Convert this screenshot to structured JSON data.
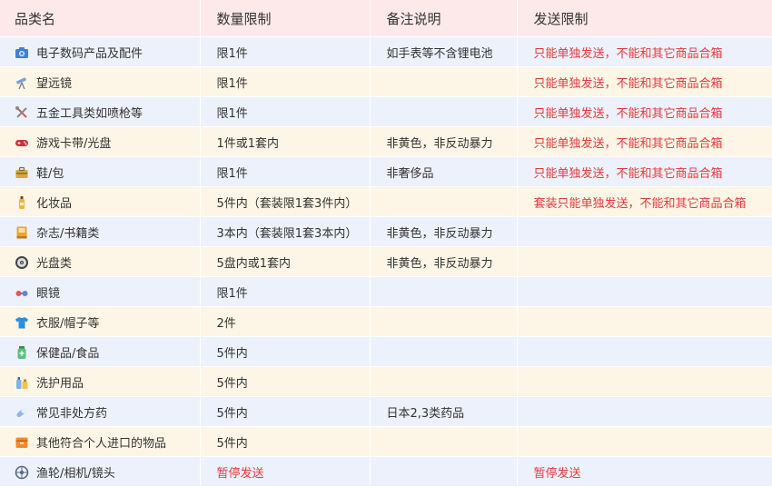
{
  "headers": [
    "品类名",
    "数量限制",
    "备注说明",
    "发送限制"
  ],
  "rows": [
    {
      "icon": "camera-icon",
      "name": "电子数码产品及配件",
      "qty": "限1件",
      "note": "如手表等不含锂电池",
      "send": "只能单独发送，不能和其它商品合箱"
    },
    {
      "icon": "telescope-icon",
      "name": "望远镜",
      "qty": "限1件",
      "note": "",
      "send": "只能单独发送，不能和其它商品合箱"
    },
    {
      "icon": "tools-icon",
      "name": "五金工具类如喷枪等",
      "qty": "限1件",
      "note": "",
      "send": "只能单独发送，不能和其它商品合箱"
    },
    {
      "icon": "gamepad-icon",
      "name": "游戏卡带/光盘",
      "qty": "1件或1套内",
      "note": "非黄色，非反动暴力",
      "send": "只能单独发送，不能和其它商品合箱"
    },
    {
      "icon": "bag-icon",
      "name": "鞋/包",
      "qty": "限1件",
      "note": "非奢侈品",
      "send": "只能单独发送，不能和其它商品合箱"
    },
    {
      "icon": "cosmetics-bottle-icon",
      "name": "化妆品",
      "qty": "5件内（套装限1套3件内）",
      "note": "",
      "send": "套装只能单独发送，不能和其它商品合箱"
    },
    {
      "icon": "book-icon",
      "name": "杂志/书籍类",
      "qty": "3本内（套装限1套3本内）",
      "note": "非黄色，非反动暴力",
      "send": ""
    },
    {
      "icon": "disc-icon",
      "name": "光盘类",
      "qty": "5盘内或1套内",
      "note": "非黄色，非反动暴力",
      "send": ""
    },
    {
      "icon": "glasses-icon",
      "name": "眼镜",
      "qty": "限1件",
      "note": "",
      "send": ""
    },
    {
      "icon": "tshirt-icon",
      "name": "衣服/帽子等",
      "qty": "2件",
      "note": "",
      "send": ""
    },
    {
      "icon": "health-food-icon",
      "name": "保健品/食品",
      "qty": "5件内",
      "note": "",
      "send": ""
    },
    {
      "icon": "toiletries-icon",
      "name": "洗护用品",
      "qty": "5件内",
      "note": "",
      "send": ""
    },
    {
      "icon": "pill-icon",
      "name": "常见非处方药",
      "qty": "5件内",
      "note": "日本2,3类药品",
      "send": ""
    },
    {
      "icon": "box-icon",
      "name": "其他符合个人进口的物品",
      "qty": "5件内",
      "note": "",
      "send": ""
    },
    {
      "icon": "reel-icon",
      "name": "渔轮/相机/镜头",
      "qty": "暂停发送",
      "note": "",
      "send": "暂停发送",
      "qty_red": true
    }
  ],
  "colors": {
    "header_bg": "#fde9ea",
    "row_blue": "#edf1fb",
    "row_yellow": "#fdf6e6",
    "warning_red": "#e5383d"
  }
}
